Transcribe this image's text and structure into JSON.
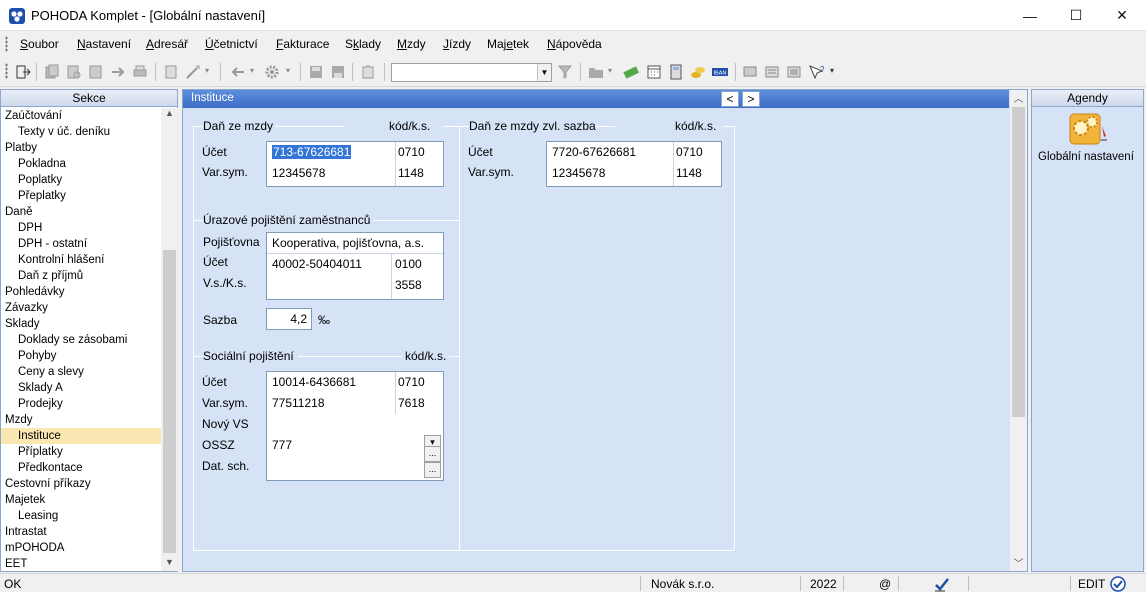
{
  "window": {
    "title": "POHODA Komplet - [Globální nastavení]",
    "minimize": "—",
    "maximize": "☐",
    "close": "✕"
  },
  "menu": [
    {
      "pre": "",
      "u": "S",
      "post": "oubor"
    },
    {
      "pre": "",
      "u": "N",
      "post": "astavení"
    },
    {
      "pre": "",
      "u": "A",
      "post": "dresář"
    },
    {
      "pre": "",
      "u": "Ú",
      "post": "četnictví"
    },
    {
      "pre": "",
      "u": "F",
      "post": "akturace"
    },
    {
      "pre": "S",
      "u": "k",
      "post": "lady"
    },
    {
      "pre": "",
      "u": "M",
      "post": "zdy"
    },
    {
      "pre": "",
      "u": "J",
      "post": "ízdy"
    },
    {
      "pre": "Maj",
      "u": "e",
      "post": "tek"
    },
    {
      "pre": "",
      "u": "N",
      "post": "ápověda"
    }
  ],
  "sections": {
    "header": "Sekce",
    "items": [
      {
        "label": "Zaúčtování",
        "level": 1
      },
      {
        "label": "Texty v úč. deníku",
        "level": 2
      },
      {
        "label": "Platby",
        "level": 1
      },
      {
        "label": "Pokladna",
        "level": 2
      },
      {
        "label": "Poplatky",
        "level": 2
      },
      {
        "label": "Přeplatky",
        "level": 2
      },
      {
        "label": "Daně",
        "level": 1
      },
      {
        "label": "DPH",
        "level": 2
      },
      {
        "label": "DPH - ostatní",
        "level": 2
      },
      {
        "label": "Kontrolní hlášení",
        "level": 2
      },
      {
        "label": "Daň z příjmů",
        "level": 2
      },
      {
        "label": "Pohledávky",
        "level": 1
      },
      {
        "label": "Závazky",
        "level": 1
      },
      {
        "label": "Sklady",
        "level": 1
      },
      {
        "label": "Doklady se zásobami",
        "level": 2
      },
      {
        "label": "Pohyby",
        "level": 2
      },
      {
        "label": "Ceny a slevy",
        "level": 2
      },
      {
        "label": "Sklady A",
        "level": 2
      },
      {
        "label": "Prodejky",
        "level": 2
      },
      {
        "label": "Mzdy",
        "level": 1
      },
      {
        "label": "Instituce",
        "level": 2,
        "selected": true
      },
      {
        "label": "Příplatky",
        "level": 2
      },
      {
        "label": "Předkontace",
        "level": 2
      },
      {
        "label": "Cestovní příkazy",
        "level": 1
      },
      {
        "label": "Majetek",
        "level": 1
      },
      {
        "label": "Leasing",
        "level": 2
      },
      {
        "label": "Intrastat",
        "level": 1
      },
      {
        "label": "mPOHODA",
        "level": 1
      },
      {
        "label": "EET",
        "level": 1
      }
    ]
  },
  "form": {
    "header": "Instituce",
    "nav_prev": "<",
    "nav_next": ">",
    "dan_ze_mzdy": {
      "title": "Daň ze mzdy",
      "code_header": "kód/k.s.",
      "ucet_label": "Účet",
      "ucet_value": "713-67626681",
      "ucet_code": "0710",
      "varsym_label": "Var.sym.",
      "varsym_value": "12345678",
      "varsym_code": "1148"
    },
    "dan_zvl": {
      "title": "Daň ze mzdy zvl. sazba",
      "code_header": "kód/k.s.",
      "ucet_label": "Účet",
      "ucet_value": "7720-67626681",
      "ucet_code": "0710",
      "varsym_label": "Var.sym.",
      "varsym_value": "12345678",
      "varsym_code": "1148"
    },
    "urazove": {
      "title": "Úrazové pojištění zaměstnanců",
      "pojistovna_label": "Pojišťovna",
      "pojistovna_value": "Kooperativa, pojišťovna, a.s.",
      "ucet_label": "Účet",
      "ucet_value": "40002-50404011",
      "ucet_code": "0100",
      "vsks_label": "V.s./K.s.",
      "vsks_value": "",
      "vsks_code": "3558",
      "sazba_label": "Sazba",
      "sazba_value": "4,2",
      "sazba_unit": "‰"
    },
    "socialni": {
      "title": "Sociální pojištění",
      "code_header": "kód/k.s.",
      "ucet_label": "Účet",
      "ucet_value": "10014-6436681",
      "ucet_code": "0710",
      "varsym_label": "Var.sym.",
      "varsym_value": "77511218",
      "varsym_code": "7618",
      "novyvs_label": "Nový VS",
      "ossz_label": "OSSZ",
      "ossz_value": "777",
      "datsch_label": "Dat. sch.",
      "btn_dropdown": "▾",
      "btn_more": "..."
    }
  },
  "agenda": {
    "header": "Agendy",
    "item_label": "Globální nastavení"
  },
  "status": {
    "left": "OK",
    "company": "Novák s.r.o.",
    "year": "2022",
    "at": "@",
    "mode": "EDIT"
  },
  "colors": {
    "accent": "#3d6cc5",
    "panel_bg": "#d6e2f6",
    "selected_item": "#fbe7b1"
  }
}
